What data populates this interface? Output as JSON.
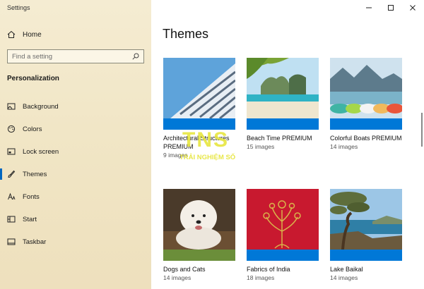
{
  "app_title": "Settings",
  "sidebar": {
    "home_label": "Home",
    "search_placeholder": "Find a setting",
    "section_title": "Personalization",
    "items": [
      {
        "label": "Background",
        "icon": "picture-icon"
      },
      {
        "label": "Colors",
        "icon": "palette-icon"
      },
      {
        "label": "Lock screen",
        "icon": "lock-screen-icon"
      },
      {
        "label": "Themes",
        "icon": "brush-icon",
        "active": true
      },
      {
        "label": "Fonts",
        "icon": "font-icon"
      },
      {
        "label": "Start",
        "icon": "start-icon"
      },
      {
        "label": "Taskbar",
        "icon": "taskbar-icon"
      }
    ]
  },
  "main": {
    "title": "Themes",
    "themes": [
      {
        "name": "Architectural Structures PREMIUM",
        "count": "9 images",
        "stripe": "#0078d7"
      },
      {
        "name": "Beach Time PREMIUM",
        "count": "15 images",
        "stripe": "#0078d7"
      },
      {
        "name": "Colorful Boats PREMIUM",
        "count": "14 images",
        "stripe": "#0078d7"
      },
      {
        "name": "Dogs and Cats",
        "count": "14 images",
        "stripe": "#6b8e3a"
      },
      {
        "name": "Fabrics of India",
        "count": "18 images",
        "stripe": "#0078d7"
      },
      {
        "name": "Lake Baikal",
        "count": "14 images",
        "stripe": "#0078d7"
      }
    ]
  },
  "watermark": {
    "logo": "TNS",
    "tagline": "TRẢI NGHIỆM SỐ"
  },
  "accent_color": "#0067c0"
}
